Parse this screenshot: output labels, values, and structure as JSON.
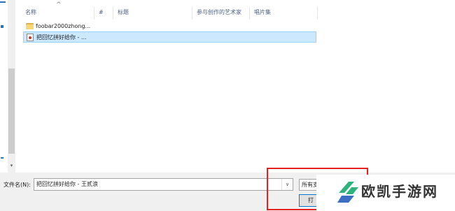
{
  "columns": {
    "name": "名称",
    "number": "#",
    "title": "标题",
    "artist": "参与创作的艺术家",
    "album": "唱片集"
  },
  "files": [
    {
      "name": "foobar2000zhong...",
      "type": "folder",
      "selected": false
    },
    {
      "name": "把回忆拼好给你 - ...",
      "type": "audio",
      "selected": true
    }
  ],
  "filename": {
    "label": "文件名(N):",
    "value": "把回忆拼好给你 - 王贰浪"
  },
  "filter": {
    "value": "所有支"
  },
  "open_button": {
    "label": "打"
  },
  "watermark": {
    "text": "欧凯手游网"
  },
  "colors": {
    "accent": "#0078d7",
    "selection": "#cce8ff",
    "highlight_box": "#e5201f",
    "logo_green": "#2db37c",
    "logo_blue": "#3b6fc4"
  }
}
